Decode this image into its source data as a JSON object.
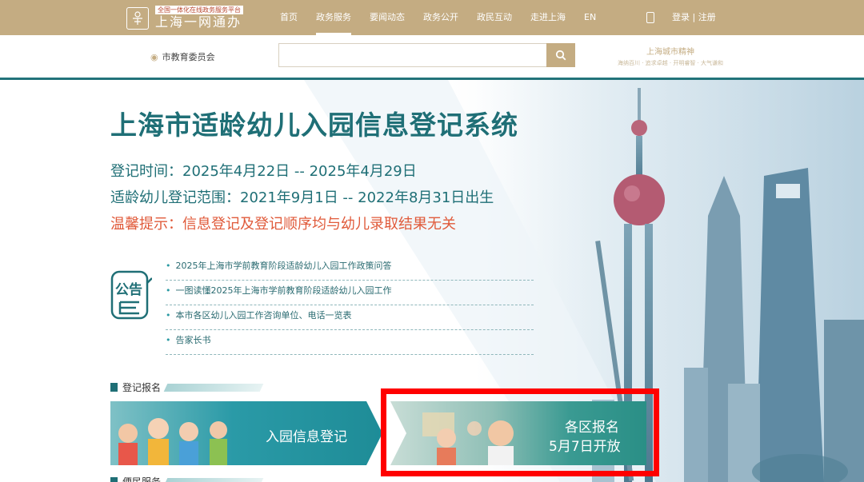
{
  "header": {
    "logo_subtitle": "全国一体化在线政务服务平台",
    "logo_title": "上海一网通办",
    "nav": [
      "首页",
      "政务服务",
      "要闻动态",
      "政务公开",
      "政民互动",
      "走进上海",
      "EN"
    ],
    "active_nav": "政务服务",
    "login": "登录 | 注册"
  },
  "subbar": {
    "department": "市教育委员会",
    "search_placeholder": "",
    "slogan_title": "上海城市精神",
    "slogan_sub": "海纳百川 · 追求卓越 · 开明睿智 · 大气谦和"
  },
  "hero": {
    "title": "上海市适龄幼儿入园信息登记系统",
    "register_time": "登记时间：2025年4月22日 -- 2025年4月29日",
    "age_range": "适龄幼儿登记范围：2021年9月1日 -- 2022年8月31日出生",
    "tip": "温馨提示：信息登记及登记顺序均与幼儿录取结果无关"
  },
  "notice": {
    "icon_text": "公告",
    "items": [
      "2025年上海市学前教育阶段适龄幼儿入园工作政策问答",
      "一图读懂2025年上海市学前教育阶段适龄幼儿入园工作",
      "本市各区幼儿入园工作咨询单位、电话一览表",
      "告家长书"
    ]
  },
  "sections": {
    "register": "登记报名",
    "service": "便民服务"
  },
  "cards": {
    "info_register": "入园信息登记",
    "district_line1": "各区报名",
    "district_line2": "5月7日开放"
  },
  "colors": {
    "header_bg": "#c4ac82",
    "teal": "#1f6f76",
    "alert": "#e05a3a",
    "highlight": "#ff0000"
  }
}
